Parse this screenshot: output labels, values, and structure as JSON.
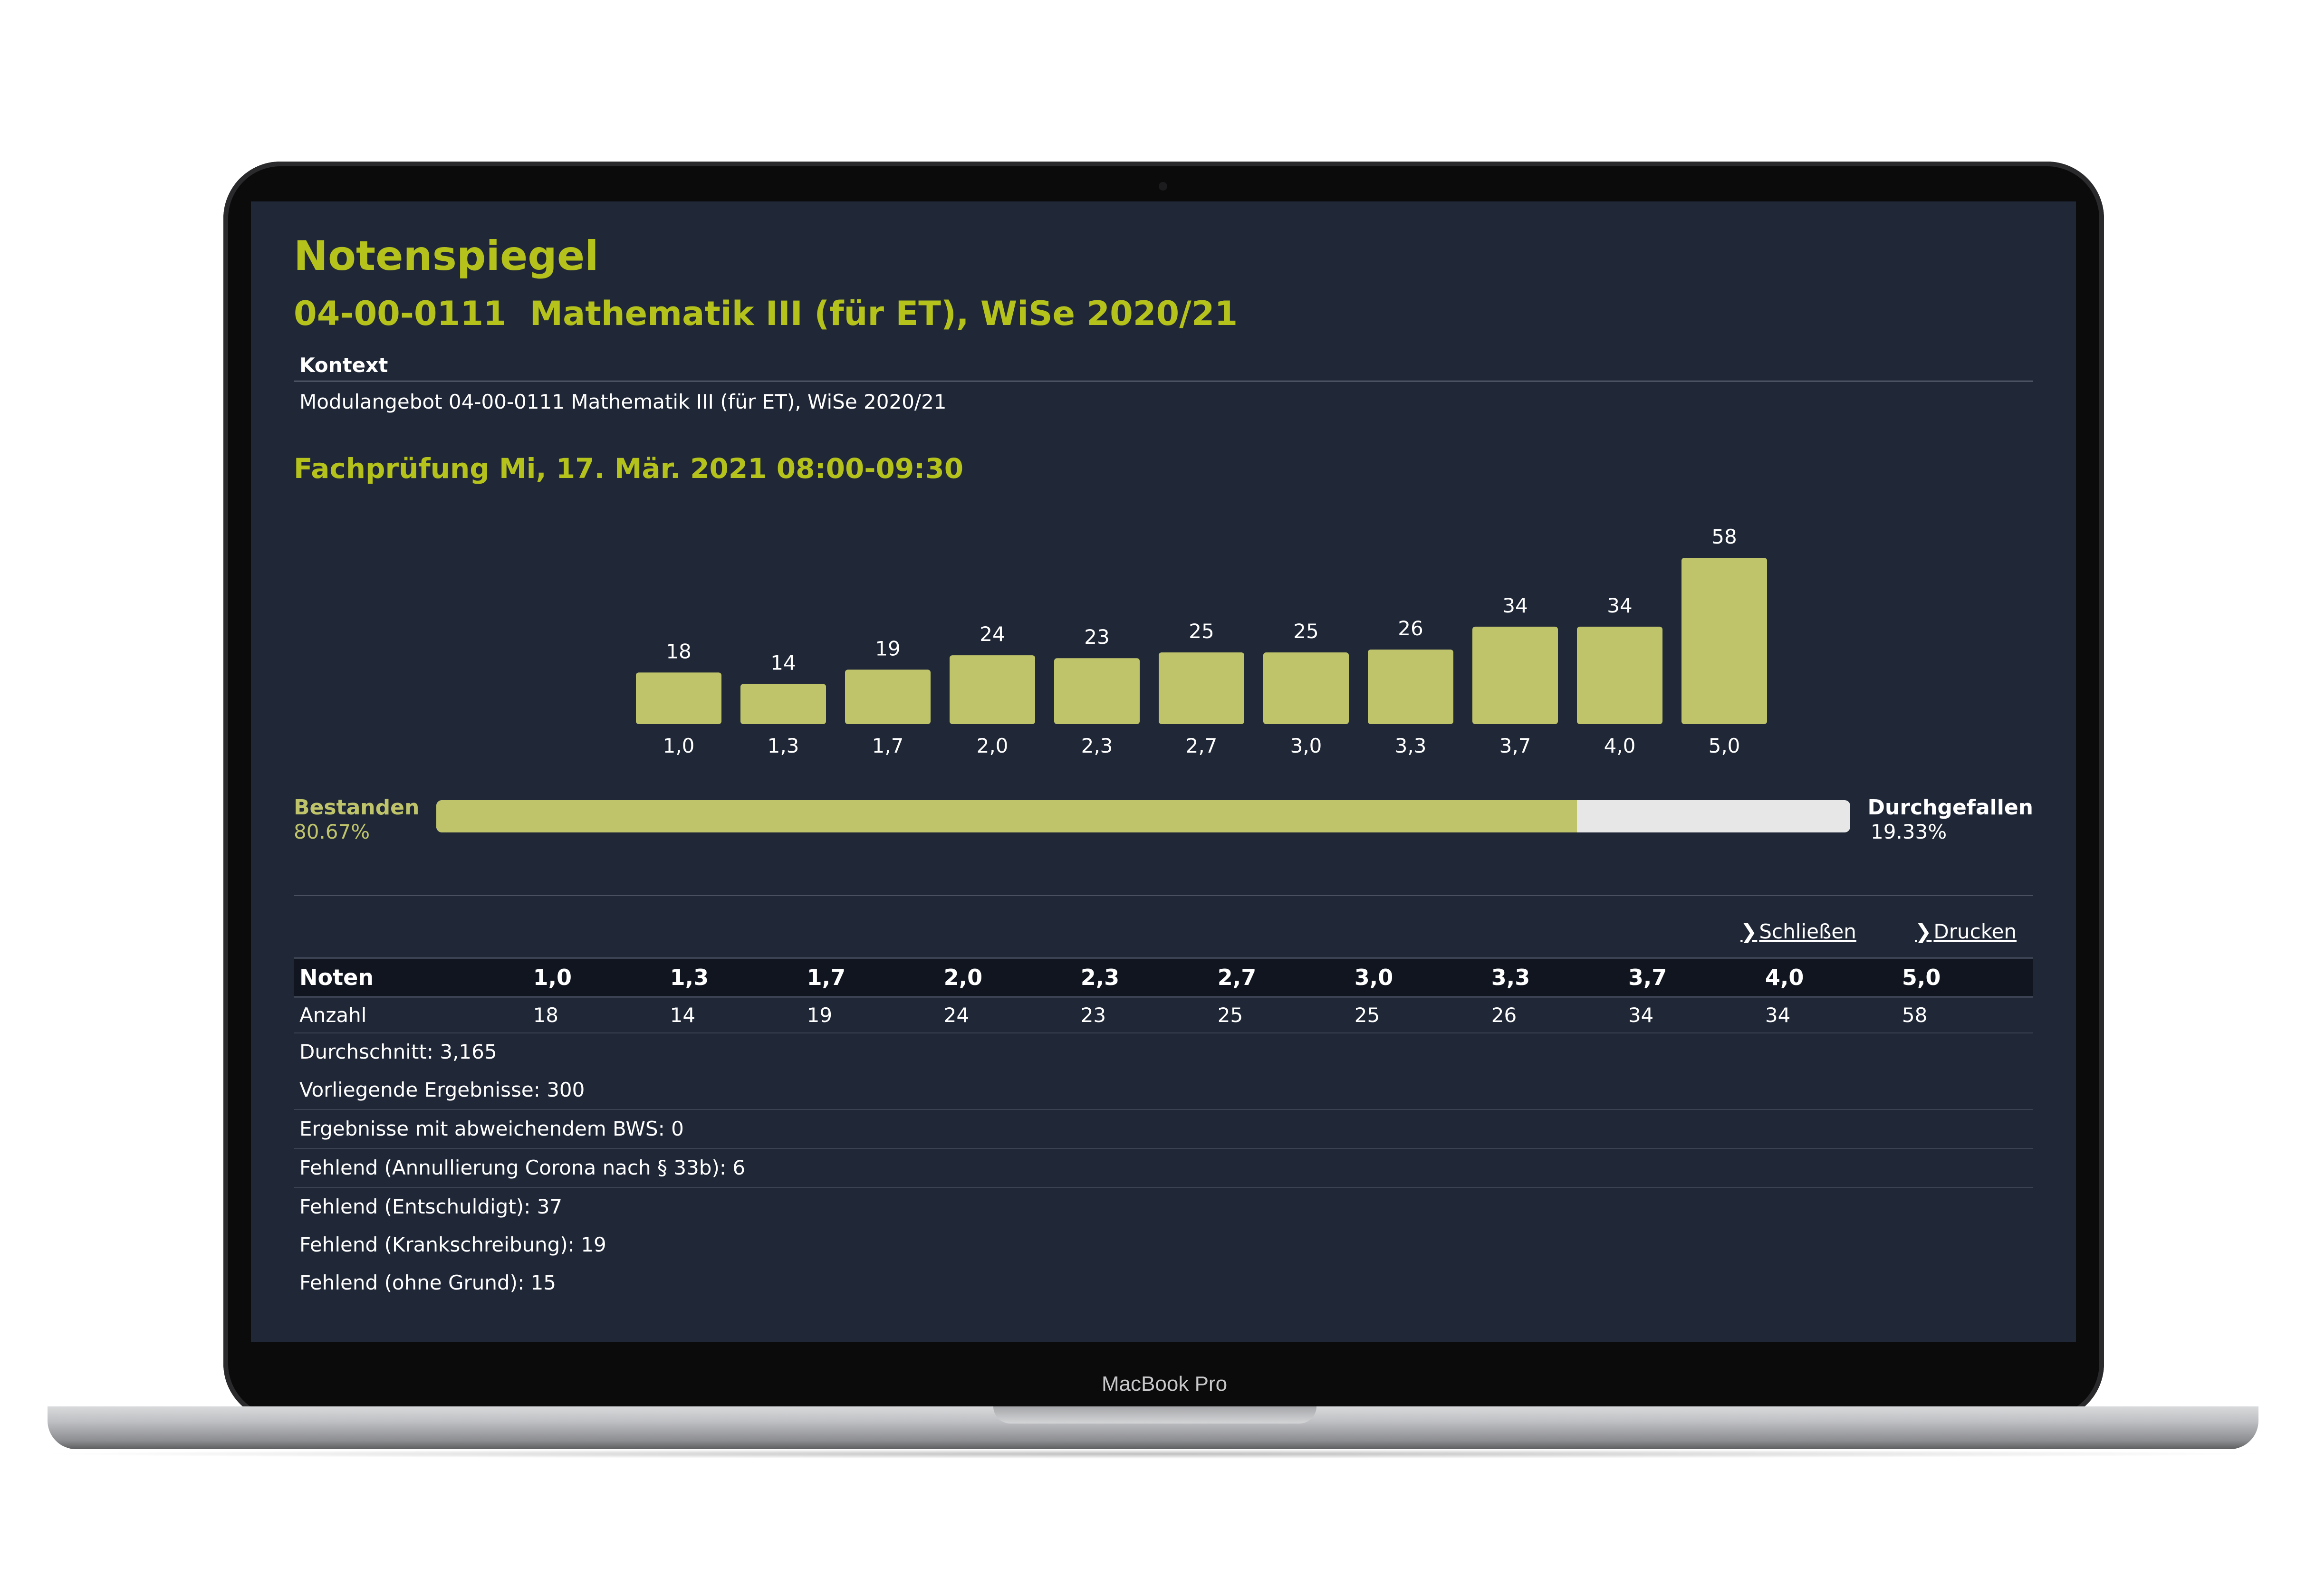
{
  "device": {
    "brand": "MacBook Pro"
  },
  "page": {
    "title": "Notenspiegel",
    "subtitle": "04-00-0111  Mathematik III (für ET), WiSe 2020/21",
    "context_header": "Kontext",
    "context_value": "Modulangebot 04-00-0111 Mathematik III (für ET), WiSe 2020/21",
    "exam_title": "Fachprüfung Mi, 17. Mär. 2021 08:00-09:30"
  },
  "chart_data": {
    "type": "bar",
    "categories": [
      "1,0",
      "1,3",
      "1,7",
      "2,0",
      "2,3",
      "2,7",
      "3,0",
      "3,3",
      "3,7",
      "4,0",
      "5,0"
    ],
    "values": [
      18,
      14,
      19,
      24,
      23,
      25,
      25,
      26,
      34,
      34,
      58
    ],
    "bar_color": "#bfc46a",
    "value_labels": true,
    "grid": false
  },
  "result_bar": {
    "pass_label": "Bestanden",
    "pass_pct": "80.67%",
    "pass_fraction": 0.8067,
    "fail_label": "Durchgefallen",
    "fail_pct": "19.33%",
    "pass_color": "#bfc46a",
    "fail_color": "#e7e7e7"
  },
  "actions": {
    "close": "Schließen",
    "print": "Drucken",
    "chevron": "❯"
  },
  "table": {
    "header_label": "Noten",
    "grades": [
      "1,0",
      "1,3",
      "1,7",
      "2,0",
      "2,3",
      "2,7",
      "3,0",
      "3,3",
      "3,7",
      "4,0",
      "5,0"
    ],
    "count_label": "Anzahl",
    "counts": [
      "18",
      "14",
      "19",
      "24",
      "23",
      "25",
      "25",
      "26",
      "34",
      "34",
      "58"
    ]
  },
  "stats": [
    "Durchschnitt: 3,165",
    "Vorliegende Ergebnisse: 300",
    "Ergebnisse mit abweichendem BWS: 0",
    "Fehlend (Annullierung Corona nach § 33b): 6",
    "Fehlend (Entschuldigt): 37",
    "Fehlend (Krankschreibung): 19",
    "Fehlend (ohne Grund): 15"
  ],
  "colors": {
    "accent": "#b5c21b",
    "screen_bg": "#202838",
    "text": "#ffffff"
  }
}
